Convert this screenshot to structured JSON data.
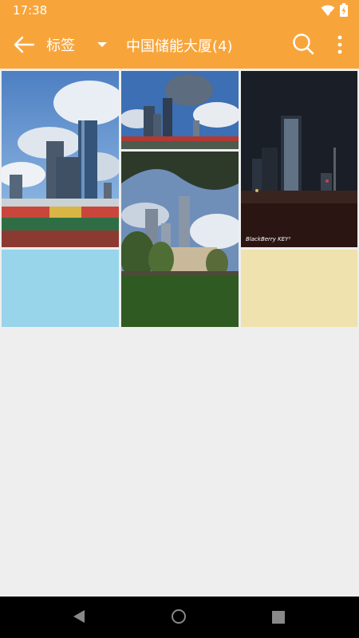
{
  "status_bar": {
    "time": "17:38",
    "icons": [
      "wifi-icon",
      "battery-charging-icon"
    ]
  },
  "app_bar": {
    "spinner_label": "标签",
    "title": "中国储能大厦(4)",
    "accent_color": "#f7a53b",
    "actions": [
      "search-icon",
      "more-vert-icon"
    ]
  },
  "grid": {
    "tiles": [
      {
        "kind": "photo",
        "subject": "stadium-with-skyscrapers-day"
      },
      {
        "kind": "photo",
        "subject": "skyscrapers-clouds"
      },
      {
        "kind": "photo",
        "subject": "skyscraper-night"
      },
      {
        "kind": "photo",
        "subject": "skyscrapers-from-park"
      },
      {
        "kind": "placeholder",
        "color": "#98d4ea"
      },
      {
        "kind": "placeholder",
        "color": "#efe2ae"
      }
    ],
    "watermark": "BlackBerry KEY²"
  },
  "nav_bar": {
    "buttons": [
      "back-triangle-icon",
      "home-circle-icon",
      "recents-square-icon"
    ]
  }
}
